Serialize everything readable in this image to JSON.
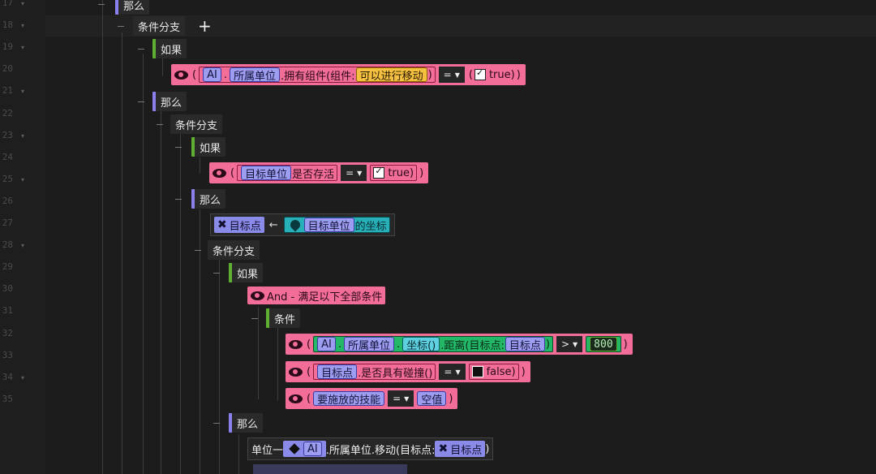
{
  "gutter": {
    "lines": [
      "17",
      "18",
      "19",
      "20",
      "21",
      "22",
      "23",
      "24",
      "25",
      "26",
      "27",
      "28",
      "29",
      "30",
      "31",
      "32",
      "33",
      "34",
      "35"
    ],
    "fold_glyph": "▾"
  },
  "toolbar": {
    "add_label": "+"
  },
  "nodes": {
    "then_top": "那么",
    "branch1": "条件分支",
    "if1": "如果",
    "then1": "那么",
    "branch2": "条件分支",
    "if2": "如果",
    "then2": "那么",
    "branch3": "条件分支",
    "if3": "如果",
    "and_all": "And - 满足以下全部条件",
    "conditions": "条件",
    "then3": "那么"
  },
  "cond1": {
    "open": "(",
    "ai": "AI",
    "dot": ".",
    "owner": "所属单位",
    "method": ".拥有组件(组件:",
    "component": "可以进行移动",
    "close_paren": ")",
    "op": "=",
    "open2": "(",
    "value": "true)",
    "close": ")"
  },
  "cond2": {
    "open": "(",
    "target": "目标单位",
    "method": "是否存活",
    "op": "=",
    "open2": "(",
    "value": "true)",
    "close": ")"
  },
  "assign1": {
    "var": "目标点",
    "arrow": "←",
    "target": "目标单位",
    "prop": "的坐标"
  },
  "cond3": {
    "open": "(",
    "ai": "AI",
    "dot": ".",
    "owner": "所属单位",
    "dot2": ".",
    "coord": "坐标()",
    "method": ".距离(目标点:",
    "point": "目标点",
    "close_paren": ")",
    "op": ">",
    "open2": "(",
    "value": "800",
    "close": ")"
  },
  "cond4": {
    "open": "(",
    "point": "目标点",
    "method": ".是否具有碰撞()",
    "op": "=",
    "open2": "(",
    "value": "false)",
    "close": ")"
  },
  "cond5": {
    "open": "(",
    "skill": "要施放的技能",
    "op": "=",
    "value": "空值",
    "close": ")"
  },
  "move": {
    "prefix": "单位一",
    "ai": "AI",
    "owner": ".所属单位",
    "method": ".移动(目标点:",
    "point": "目标点",
    "close": ")"
  },
  "colors": {
    "condition_pink": "#f36d99",
    "if_green": "#5fb030",
    "then_purple": "#8a80ee",
    "variable_lavender": "#9c9cf0",
    "component_yellow": "#f5c040"
  }
}
